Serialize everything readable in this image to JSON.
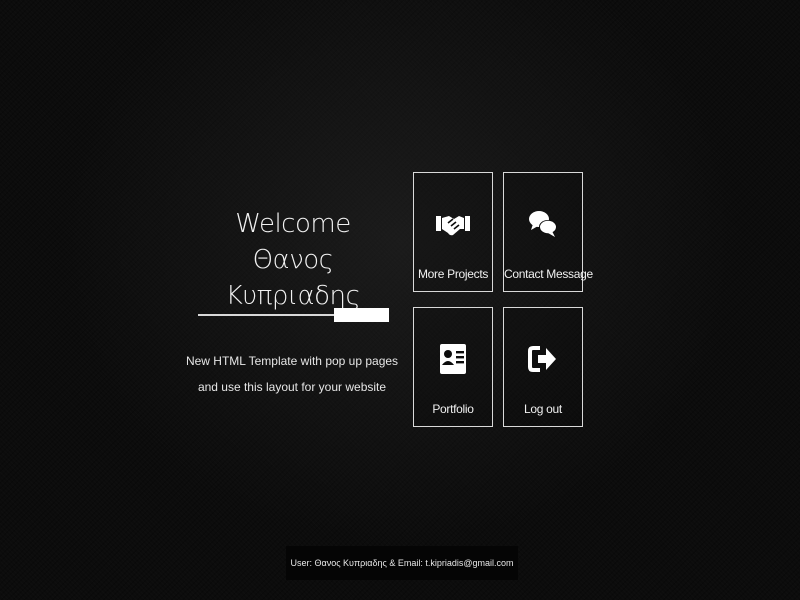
{
  "welcome": {
    "line1": "Welcome",
    "line2": "Θανος Κυπριαδης"
  },
  "subtitle": {
    "line1": "New HTML Template with pop up pages",
    "line2": "and use this layout for your website"
  },
  "tiles": [
    {
      "label": "More Projects",
      "icon": "handshake-icon"
    },
    {
      "label": "Contact Message",
      "icon": "chat-bubbles-icon"
    },
    {
      "label": "Portfolio",
      "icon": "id-card-icon"
    },
    {
      "label": "Log out",
      "icon": "sign-out-icon"
    }
  ],
  "footer": {
    "text": "User: Θανος Κυπριαδης & Email: t.kipriadis@gmail.com"
  },
  "colors": {
    "background": "#0c0c0c",
    "foreground": "#ffffff",
    "tile_border": "#d9d9d9"
  }
}
